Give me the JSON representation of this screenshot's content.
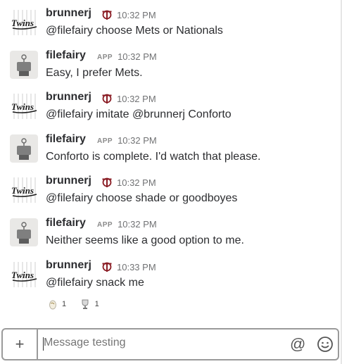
{
  "messages": [
    {
      "author": "brunnerj",
      "avatar": "twins-logo",
      "badge": "twins-t-icon",
      "time": "10:32 PM",
      "text": "@filefairy choose Mets or Nationals"
    },
    {
      "author": "filefairy",
      "avatar": "fairy-robot",
      "badge": "APP",
      "time": "10:32 PM",
      "text": "Easy, I prefer Mets."
    },
    {
      "author": "brunnerj",
      "avatar": "twins-logo",
      "badge": "twins-t-icon",
      "time": "10:32 PM",
      "text_prefix": "@filefairy imitate ",
      "text_mention": "@brunnerj",
      "text_suffix": " Conforto"
    },
    {
      "author": "filefairy",
      "avatar": "fairy-robot",
      "badge": "APP",
      "time": "10:32 PM",
      "text": "Conforto is complete. I'd watch that please."
    },
    {
      "author": "brunnerj",
      "avatar": "twins-logo",
      "badge": "twins-t-icon",
      "time": "10:32 PM",
      "text": "@filefairy choose shade or goodboyes"
    },
    {
      "author": "filefairy",
      "avatar": "fairy-robot",
      "badge": "APP",
      "time": "10:32 PM",
      "text": "Neither seems like a good option to me."
    },
    {
      "author": "brunnerj",
      "avatar": "twins-logo",
      "badge": "twins-t-icon",
      "time": "10:33 PM",
      "text": "@filefairy snack me"
    }
  ],
  "reactions": [
    {
      "icon": "egg-icon",
      "count": "1"
    },
    {
      "icon": "trophy-icon",
      "count": "1"
    }
  ],
  "composer": {
    "placeholder": "Message testing",
    "plus_label": "+",
    "at_label": "@",
    "emoji_icon": "smiley-icon"
  }
}
